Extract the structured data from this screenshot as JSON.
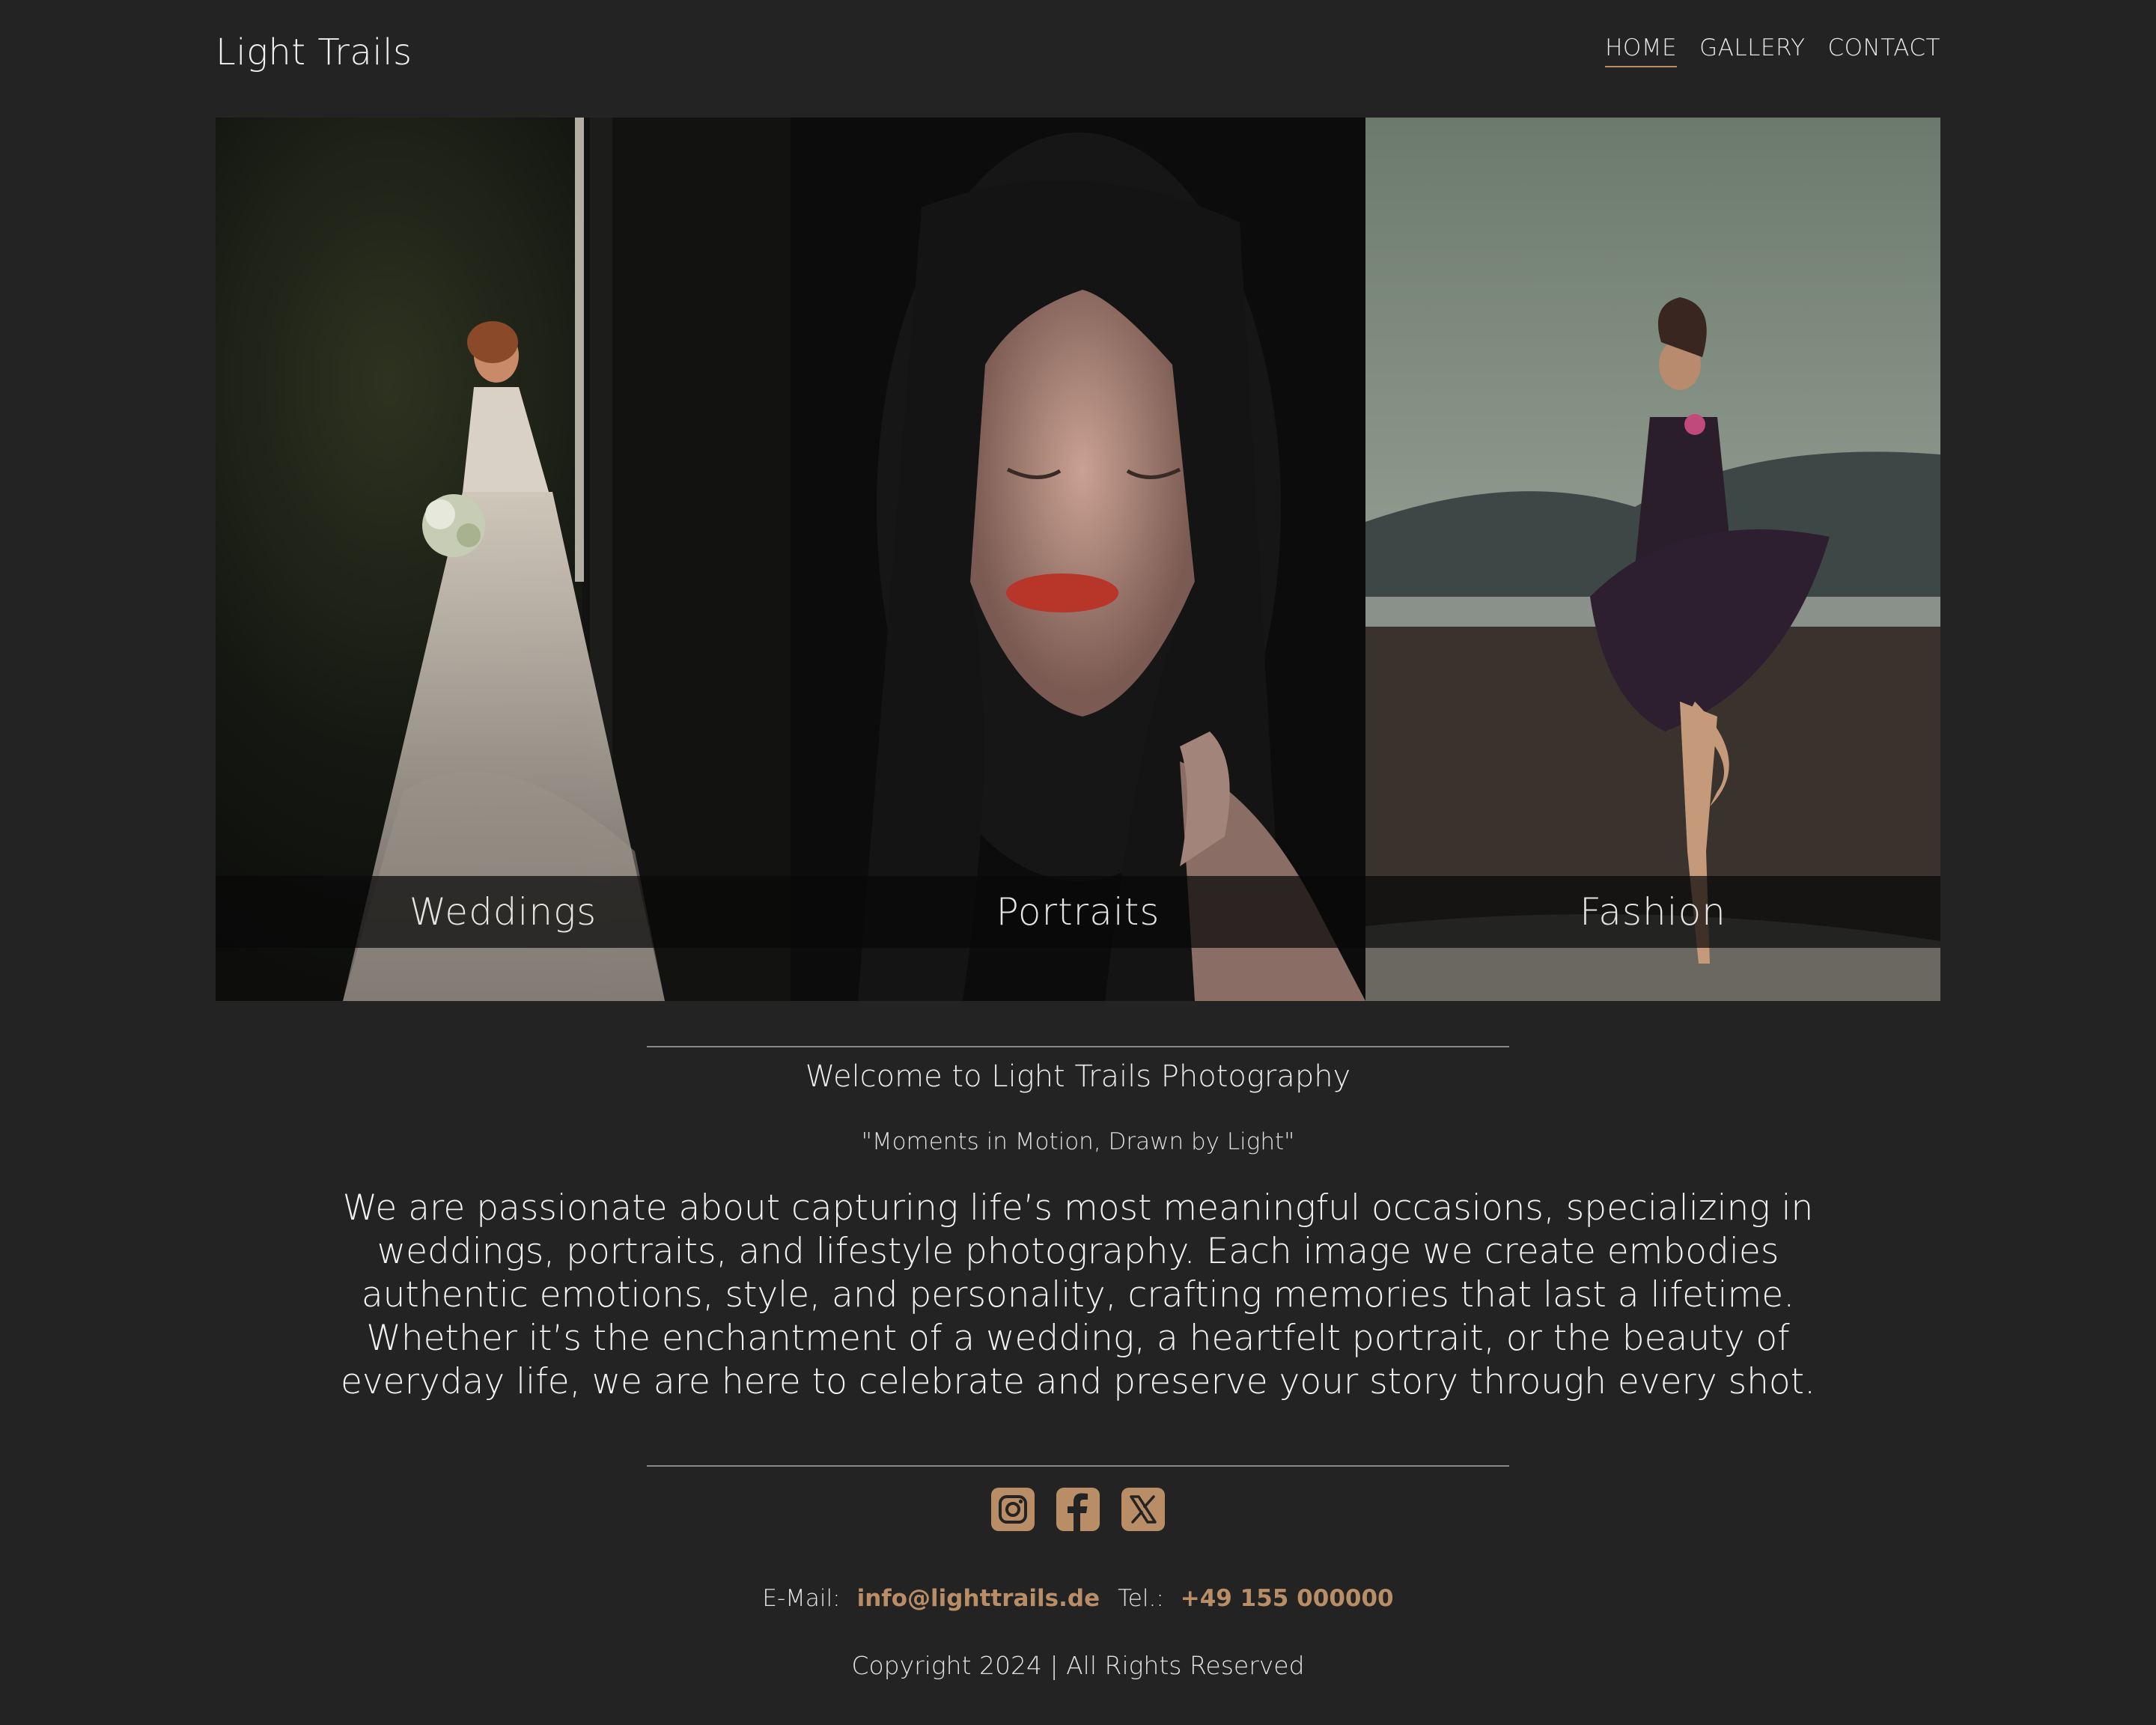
{
  "header": {
    "logo": "Light Trails",
    "nav": [
      {
        "label": "HOME",
        "active": true
      },
      {
        "label": "GALLERY",
        "active": false
      },
      {
        "label": "CONTACT",
        "active": false
      }
    ]
  },
  "gallery": [
    {
      "caption": "Weddings"
    },
    {
      "caption": "Portraits"
    },
    {
      "caption": "Fashion"
    }
  ],
  "intro": {
    "title": "Welcome to Light Trails Photography",
    "tagline": "\"Moments in Motion, Drawn by Light\"",
    "body": "We are passionate about capturing life’s most meaningful occasions, specializing in weddings, portraits, and lifestyle photography. Each image we create embodies authentic emotions, style, and personality, crafting memories that last a lifetime. Whether it’s the enchantment of a wedding, a heartfelt portrait, or the beauty of everyday life, we are here to celebrate and preserve your story through every shot."
  },
  "social": [
    {
      "icon": "instagram-icon"
    },
    {
      "icon": "facebook-icon"
    },
    {
      "icon": "x-icon"
    }
  ],
  "contact": {
    "email_label": "E-Mail:",
    "email": "info@lighttrails.de",
    "tel_label": "Tel.:",
    "tel": "+49 155 000000"
  },
  "footer": {
    "copyright": "Copyright 2024 | All Rights Reserved"
  },
  "colors": {
    "background": "#232323",
    "accent": "#b98e66",
    "text": "#f0f0f0"
  }
}
